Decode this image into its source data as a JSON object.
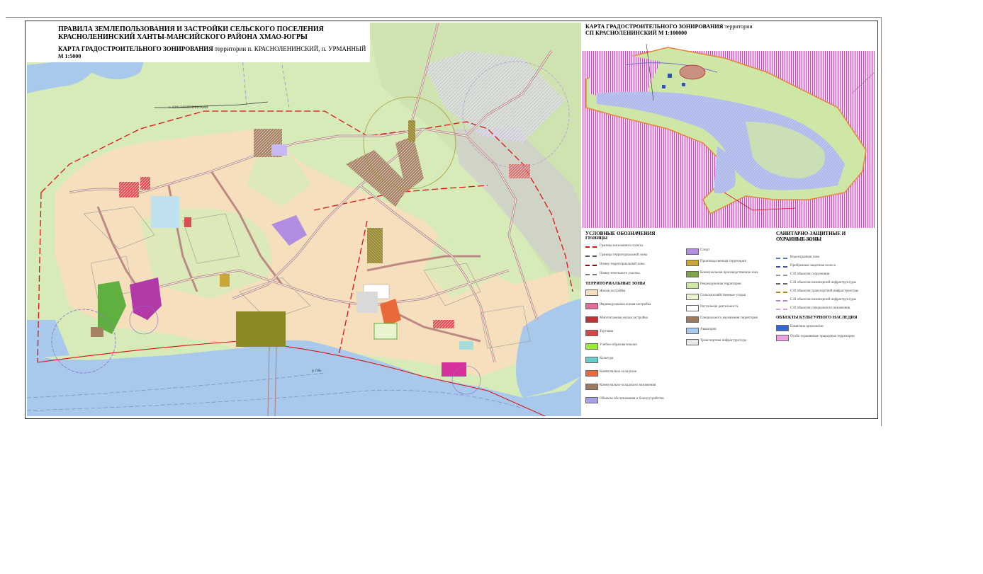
{
  "main_map": {
    "title": "ПРАВИЛА ЗЕМЛЕПОЛЬЗОВАНИЯ И ЗАСТРОЙКИ СЕЛЬСКОГО ПОСЕЛЕНИЯ КРАСНОЛЕНИНСКИЙ ХАНТЫ-МАНСИЙСКОГО РАЙОНА ХМАО-ЮГРЫ",
    "subtitle_bold": "КАРТА ГРАДОСТРОИТЕЛЬНОГО ЗОНИРОВАНИЯ",
    "subtitle_rest": " территории п. КРАСНОЛЕНИНСКИЙ, п. УРМАННЫЙ",
    "scale": "М 1:5000",
    "road_label": "п. КРАСНОЛЕНИНСКИЙ",
    "river_label": "р. Обь"
  },
  "overview_map": {
    "title_bold": "КАРТА ГРАДОСТРОИТЕЛЬНОГО ЗОНИРОВАНИЯ",
    "title_rest": " территории",
    "title_line2": "СП КРАСНОЛЕНИНСКИЙ   М 1:100000"
  },
  "legend": {
    "heading_main": "УСЛОВНЫЕ ОБОЗНАЧЕНИЯ",
    "heading_sanitary": "САНИТАРНО-ЗАЩИТНЫЕ И ОХРАННЫЕ ЗОНЫ",
    "sub_sanitary": "Водоохранные зоны",
    "heading_borders": "ГРАНИЦЫ",
    "heading_zones": "ТЕРРИТОРИАЛЬНЫЕ ЗОНЫ",
    "heading_heritage": "ОБЪЕКТЫ КУЛЬТУРНОГО НАСЛЕДИЯ",
    "borders": [
      {
        "label": "Граница населенного пункта",
        "color": "#d11"
      },
      {
        "label": "Граница территориальной зоны",
        "color": "#555"
      },
      {
        "label": "Номер территориальной зоны",
        "color": "#900"
      },
      {
        "label": "Номер земельного участка",
        "color": "#777"
      }
    ],
    "zones_left": [
      {
        "label": "Жилая застройка",
        "color": "#f6dfbd"
      },
      {
        "label": "Индивидуальная жилая застройка",
        "color": "#e76b9a"
      },
      {
        "label": "Многоэтажная жилая застройка",
        "color": "#b33"
      },
      {
        "label": "Торговая",
        "color": "#d04848"
      },
      {
        "label": "Учебно-образовательная",
        "color": "#9e3"
      },
      {
        "label": "Культура",
        "color": "#6cc"
      },
      {
        "label": "Коммунально-складская",
        "color": "#e86a3a"
      },
      {
        "label": "Коммунально-складского назначения",
        "color": "#9e7a62"
      },
      {
        "label": "Объекты обслуживания и благоустройства",
        "color": "#a8a0e8"
      }
    ],
    "zones_mid": [
      {
        "label": "Спорт",
        "color": "#b08de0"
      },
      {
        "label": "Производственная территория",
        "color": "#c9a53a"
      },
      {
        "label": "Коммунальная производственная зона",
        "color": "#7ea34c"
      },
      {
        "label": "Рекреационная территория",
        "color": "#cfe7a6"
      },
      {
        "label": "Сельскохозяйственные угодья",
        "color": "#e8f4d0"
      },
      {
        "label": "Ритуальная деятельность",
        "color": "#ffffff"
      },
      {
        "label": "Специального назначения территория",
        "color": "#9e7a62"
      },
      {
        "label": "Акватория",
        "color": "#a8c8ec"
      },
      {
        "label": "Транспортная инфраструктура",
        "color": "#e8e8e8"
      }
    ],
    "sanitary": [
      {
        "label": "Водоохранная зона",
        "color": "#5577cc"
      },
      {
        "label": "Прибрежная защитная полоса",
        "color": "#3355aa"
      },
      {
        "label": "СЗЗ объектов сооружения",
        "color": "#999"
      },
      {
        "label": "СЗЗ объектов инженерной инфраструктуры",
        "color": "#666"
      },
      {
        "label": "СЗЗ объектов транспортной инфраструктуры",
        "color": "#b8860b"
      },
      {
        "label": "СЗЗ объектов инженерной инфраструктуры",
        "color": "#c080d0"
      },
      {
        "label": "СЗЗ объектов специального назначения",
        "color": "#d4a0e0"
      }
    ],
    "heritage": [
      {
        "label": "Памятник археологии",
        "color": "#3366cc"
      },
      {
        "label": "Особо охраняемые природные территории",
        "color": "#f0a0e0"
      }
    ]
  },
  "colors": {
    "forest": "#c8e6a0",
    "residential": "#f6dfbd",
    "water": "#a8c8ec",
    "border_red": "#d11",
    "road": "#c89090",
    "overview_purple": "#d040c0"
  }
}
